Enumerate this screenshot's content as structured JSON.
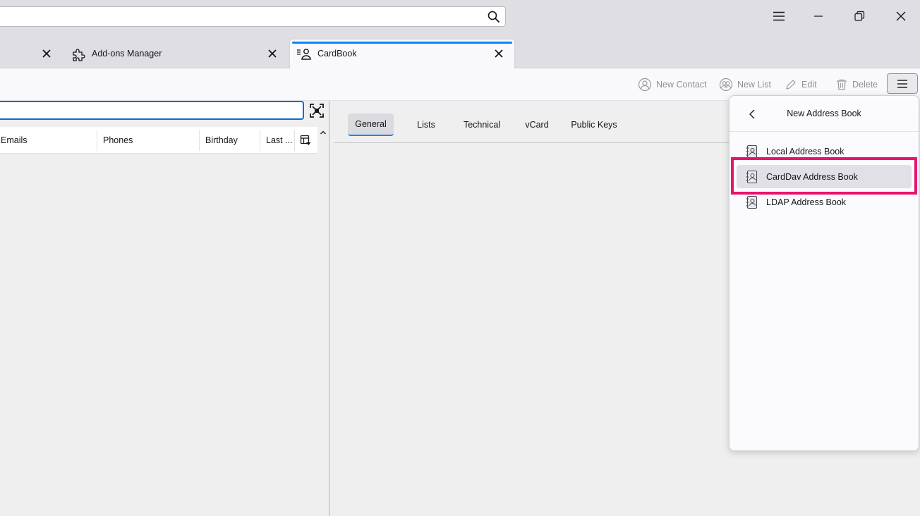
{
  "window": {
    "search_placeholder": "",
    "buttons": [
      "menu",
      "minimize",
      "restore",
      "close"
    ]
  },
  "tabs": [
    {
      "label": "",
      "active": false
    },
    {
      "label": "Add-ons Manager",
      "active": false
    },
    {
      "label": "CardBook",
      "active": true
    }
  ],
  "toolbar": {
    "new_contact": "New Contact",
    "new_list": "New List",
    "edit": "Edit",
    "delete": "Delete"
  },
  "contacts": {
    "filter_value": "",
    "columns": [
      "Emails",
      "Phones",
      "Birthday",
      "Last ..."
    ]
  },
  "detail_tabs": [
    "General",
    "Lists",
    "Technical",
    "vCard",
    "Public Keys"
  ],
  "selected_detail_tab": "General",
  "popup": {
    "title": "New Address Book",
    "items": [
      {
        "label": "Local Address Book",
        "icon": "address-book-icon"
      },
      {
        "label": "CardDav Address Book",
        "icon": "address-book-icon",
        "highlighted": true
      },
      {
        "label": "LDAP Address Book",
        "icon": "address-book-icon"
      }
    ]
  },
  "colors": {
    "accent": "#0a84ff",
    "highlight": "#e8146c"
  }
}
